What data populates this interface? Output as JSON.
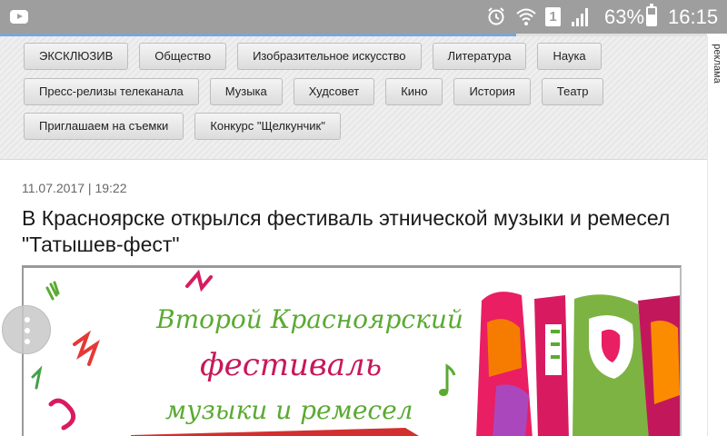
{
  "status_bar": {
    "app_icon": "youtube-icon",
    "icons": [
      "alarm-icon",
      "wifi-icon",
      "sim-icon",
      "signal-icon",
      "battery-icon"
    ],
    "sim_label": "1",
    "battery_text": "63%",
    "battery_level": 0.63,
    "time": "16:15"
  },
  "page_load_progress": 0.73,
  "categories": {
    "row1": [
      "ЭКСКЛЮЗИВ",
      "Общество",
      "Изобразительное искусство",
      "Литература",
      "Наука"
    ],
    "row2": [
      "Пресс-релизы телеканала",
      "Музыка",
      "Худсовет",
      "Кино",
      "История",
      "Театр"
    ],
    "row3": [
      "Приглашаем на съемки",
      "Конкурс \"Щелкунчик\""
    ]
  },
  "ad_label": "реклама",
  "article": {
    "date": "11.07.2017 | 19:22",
    "title": "В Красноярске открылся фестиваль этнической музыки и ремесел \"Татышев-фест\""
  },
  "poster": {
    "line1": "Второй Красноярский",
    "line2": "фестиваль",
    "line3": "музыки и ремесел"
  },
  "colors": {
    "status_bar": "#9e9e9e",
    "progress": "#7aa4dc",
    "poster_green": "#5aaa32",
    "poster_magenta": "#c8185a"
  },
  "floating_button_icon": "more-vert-icon"
}
